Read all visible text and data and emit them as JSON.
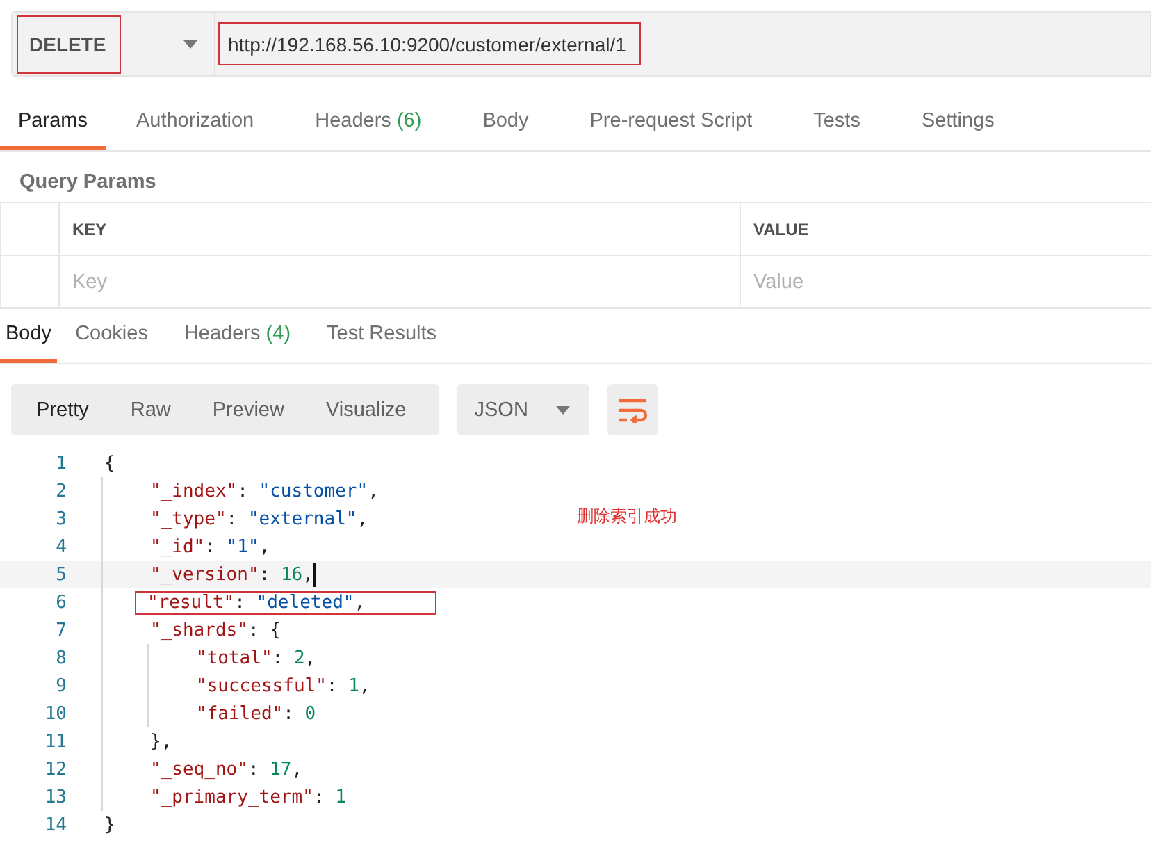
{
  "request": {
    "method": {
      "value": "DELETE",
      "boxed": true
    },
    "url": {
      "value": "http://192.168.56.10:9200/customer/external/1",
      "boxed": true
    }
  },
  "request_tabs": [
    {
      "label": "Params",
      "selected": true
    },
    {
      "label": "Authorization",
      "selected": false
    },
    {
      "label": "Headers",
      "count": "(6)",
      "selected": false
    },
    {
      "label": "Body",
      "selected": false
    },
    {
      "label": "Pre-request Script",
      "selected": false
    },
    {
      "label": "Tests",
      "selected": false
    },
    {
      "label": "Settings",
      "selected": false
    }
  ],
  "query_params": {
    "title": "Query Params",
    "columns": [
      "KEY",
      "VALUE"
    ],
    "placeholders": [
      "Key",
      "Value"
    ]
  },
  "response_tabs": [
    {
      "label": "Body",
      "selected": true
    },
    {
      "label": "Cookies",
      "selected": false
    },
    {
      "label": "Headers",
      "count": "(4)",
      "selected": false
    },
    {
      "label": "Test Results",
      "selected": false
    }
  ],
  "view_modes": [
    {
      "label": "Pretty",
      "selected": true
    },
    {
      "label": "Raw",
      "selected": false
    },
    {
      "label": "Preview",
      "selected": false
    },
    {
      "label": "Visualize",
      "selected": false
    }
  ],
  "format": "JSON",
  "note": "删除索引成功",
  "code": [
    {
      "number": "1",
      "current": false,
      "boxed": false,
      "tokens": [
        {
          "kind": "punct",
          "text": "{"
        }
      ],
      "children": [
        {
          "number": "2",
          "current": false,
          "boxed": false,
          "tokens": [
            {
              "kind": "key",
              "text": "\"_index\""
            },
            {
              "kind": "punct",
              "text": ": "
            },
            {
              "kind": "string",
              "text": "\"customer\""
            },
            {
              "kind": "punct",
              "text": ","
            }
          ]
        },
        {
          "number": "3",
          "current": false,
          "boxed": false,
          "tokens": [
            {
              "kind": "key",
              "text": "\"_type\""
            },
            {
              "kind": "punct",
              "text": ": "
            },
            {
              "kind": "string",
              "text": "\"external\""
            },
            {
              "kind": "punct",
              "text": ","
            }
          ]
        },
        {
          "number": "4",
          "current": false,
          "boxed": false,
          "tokens": [
            {
              "kind": "key",
              "text": "\"_id\""
            },
            {
              "kind": "punct",
              "text": ": "
            },
            {
              "kind": "string",
              "text": "\"1\""
            },
            {
              "kind": "punct",
              "text": ","
            }
          ]
        },
        {
          "number": "5",
          "current": true,
          "boxed": false,
          "tokens": [
            {
              "kind": "key",
              "text": "\"_version\""
            },
            {
              "kind": "punct",
              "text": ": "
            },
            {
              "kind": "number",
              "text": "16"
            },
            {
              "kind": "punct",
              "text": ","
            }
          ]
        },
        {
          "number": "6",
          "current": false,
          "boxed": true,
          "tokens": [
            {
              "kind": "key",
              "text": "\"result\""
            },
            {
              "kind": "punct",
              "text": ": "
            },
            {
              "kind": "string",
              "text": "\"deleted\""
            },
            {
              "kind": "punct",
              "text": ","
            }
          ]
        },
        {
          "number": "7",
          "current": false,
          "boxed": false,
          "tokens": [
            {
              "kind": "key",
              "text": "\"_shards\""
            },
            {
              "kind": "punct",
              "text": ": {"
            }
          ],
          "children": [
            {
              "number": "8",
              "current": false,
              "boxed": false,
              "tokens": [
                {
                  "kind": "key",
                  "text": "\"total\""
                },
                {
                  "kind": "punct",
                  "text": ": "
                },
                {
                  "kind": "number",
                  "text": "2"
                },
                {
                  "kind": "punct",
                  "text": ","
                }
              ]
            },
            {
              "number": "9",
              "current": false,
              "boxed": false,
              "tokens": [
                {
                  "kind": "key",
                  "text": "\"successful\""
                },
                {
                  "kind": "punct",
                  "text": ": "
                },
                {
                  "kind": "number",
                  "text": "1"
                },
                {
                  "kind": "punct",
                  "text": ","
                }
              ]
            },
            {
              "number": "10",
              "current": false,
              "boxed": false,
              "tokens": [
                {
                  "kind": "key",
                  "text": "\"failed\""
                },
                {
                  "kind": "punct",
                  "text": ": "
                },
                {
                  "kind": "number",
                  "text": "0"
                }
              ]
            }
          ]
        },
        {
          "number": "11",
          "current": false,
          "boxed": false,
          "tokens": [
            {
              "kind": "punct",
              "text": "},"
            }
          ]
        },
        {
          "number": "12",
          "current": false,
          "boxed": false,
          "tokens": [
            {
              "kind": "key",
              "text": "\"_seq_no\""
            },
            {
              "kind": "punct",
              "text": ": "
            },
            {
              "kind": "number",
              "text": "17"
            },
            {
              "kind": "punct",
              "text": ","
            }
          ]
        },
        {
          "number": "13",
          "current": false,
          "boxed": false,
          "tokens": [
            {
              "kind": "key",
              "text": "\"_primary_term\""
            },
            {
              "kind": "punct",
              "text": ": "
            },
            {
              "kind": "number",
              "text": "1"
            }
          ]
        }
      ]
    },
    {
      "number": "14",
      "current": false,
      "boxed": false,
      "tokens": [
        {
          "kind": "punct",
          "text": "}"
        }
      ]
    }
  ]
}
